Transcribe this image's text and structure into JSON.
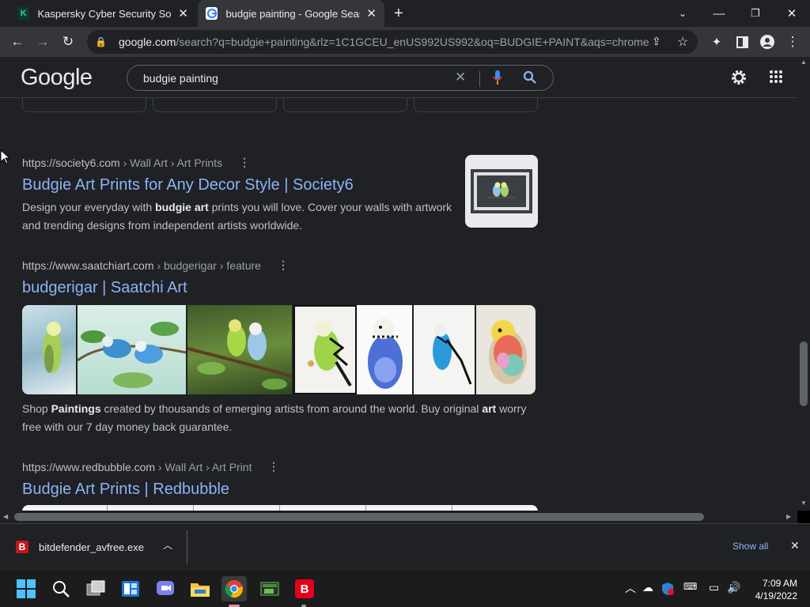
{
  "tabs": [
    {
      "title": "Kaspersky Cyber Security Solutio",
      "favicon": "kaspersky-icon"
    },
    {
      "title": "budgie painting - Google Search",
      "favicon": "google-g-icon"
    }
  ],
  "omnibox": {
    "domain": "google.com",
    "path": "/search?q=budgie+painting&rlz=1C1GCEU_enUS992US992&oq=BUDGIE+PAINT&aqs=chrome..."
  },
  "google": {
    "logo": "Google",
    "query": "budgie painting"
  },
  "results": [
    {
      "url": "https://society6.com",
      "path": " › Wall Art › Art Prints",
      "title": "Budgie Art Prints for Any Decor Style | Society6",
      "snippet_parts": [
        "Design your everyday with ",
        "budgie art",
        " prints you will love. Cover your walls with artwork and trending designs from independent artists worldwide."
      ]
    },
    {
      "url": "https://www.saatchiart.com",
      "path": " › budgerigar › feature",
      "title": "budgerigar | Saatchi Art",
      "snippet_parts": [
        "Shop ",
        "Paintings",
        " created by thousands of emerging artists from around the world. Buy original ",
        "art",
        " worry free with our 7 day money back guarantee."
      ]
    },
    {
      "url": "https://www.redbubble.com",
      "path": " › Wall Art › Art Print",
      "title": "Budgie Art Prints | Redbubble"
    }
  ],
  "download": {
    "filename": "bitdefender_avfree.exe",
    "show_all": "Show all"
  },
  "clock": {
    "time": "7:09 AM",
    "date": "4/19/2022"
  },
  "colors": {
    "link": "#8ab4f8",
    "bg": "#202124",
    "download_link": "#8ab4f8"
  }
}
